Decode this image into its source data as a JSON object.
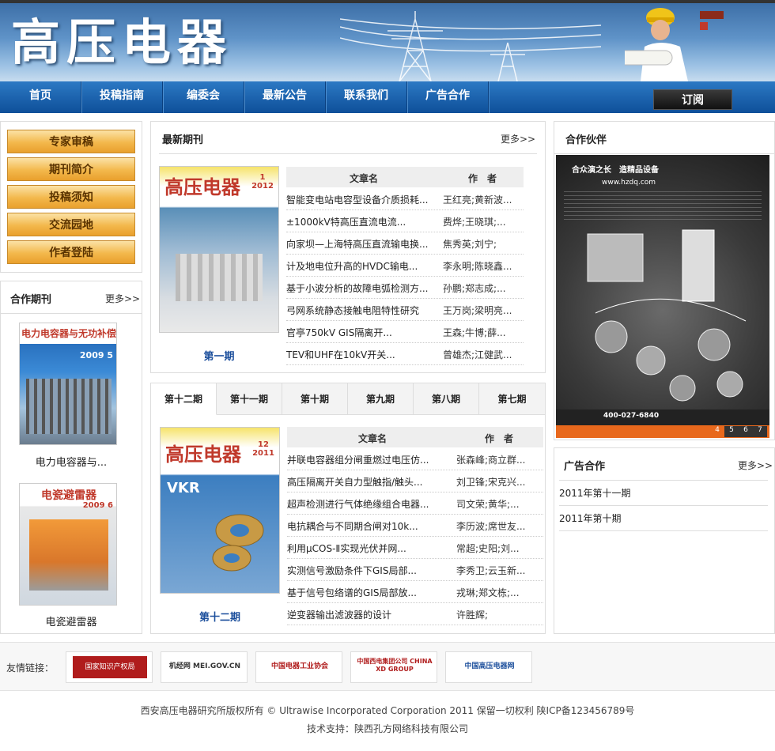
{
  "site": {
    "logo_text": "高压电器"
  },
  "nav": {
    "items": [
      "首页",
      "投稿指南",
      "编委会",
      "最新公告",
      "联系我们",
      "广告合作"
    ],
    "subscribe": "订阅"
  },
  "sidebar": {
    "buttons": [
      "专家审稿",
      "期刊简介",
      "投稿须知",
      "交流园地",
      "作者登陆"
    ]
  },
  "coop_journals": {
    "title": "合作期刊",
    "more": "更多>>",
    "items": [
      {
        "caption": "电力电容器与...",
        "cover_title": "电力电容器与无功补偿",
        "cover_issue": "2009 5"
      },
      {
        "caption": "电瓷避雷器",
        "cover_title": "电瓷避雷器",
        "cover_issue": "2009 6"
      }
    ]
  },
  "latest": {
    "title": "最新期刊",
    "more": "更多>>",
    "issue_label": "第一期",
    "cover_title": "高压电器",
    "cover_issue": "1 2012",
    "col_title": "文章名",
    "col_author": "作　者",
    "rows": [
      {
        "title": "智能变电站电容型设备介质损耗...",
        "author": "王红亮;黄新波..."
      },
      {
        "title": "±1000kV特高压直流电流...",
        "author": "费烨;王晓琪;..."
      },
      {
        "title": "向家坝—上海特高压直流输电换...",
        "author": "焦秀英;刘宁;"
      },
      {
        "title": "计及地电位升高的HVDC输电...",
        "author": "李永明;陈晓鑫..."
      },
      {
        "title": "基于小波分析的故障电弧检测方...",
        "author": "孙鹏;郑志成;..."
      },
      {
        "title": "弓网系统静态接触电阻特性研究",
        "author": "王万岗;梁明亮..."
      },
      {
        "title": "官亭750kV GIS隔离开...",
        "author": "王森;牛博;薛..."
      },
      {
        "title": "TEV和UHF在10kV开关...",
        "author": "曾雄杰;江健武..."
      }
    ]
  },
  "issues": {
    "tabs": [
      "第十二期",
      "第十一期",
      "第十期",
      "第九期",
      "第八期",
      "第七期"
    ],
    "issue_label": "第十二期",
    "cover_title": "高压电器",
    "cover_issue": "12 2011",
    "cover_brand": "VKR",
    "col_title": "文章名",
    "col_author": "作　者",
    "rows": [
      {
        "title": "并联电容器组分闸重燃过电压仿...",
        "author": "张森峰;商立群..."
      },
      {
        "title": "高压隔离开关自力型触指/触头...",
        "author": "刘卫锋;宋克兴..."
      },
      {
        "title": "超声检测进行气体绝缘组合电器...",
        "author": "司文荣;黄华;..."
      },
      {
        "title": "电抗耦合与不同期合闸对10k...",
        "author": "李历波;席世友..."
      },
      {
        "title": "利用μCOS-Ⅱ实现光伏并网...",
        "author": "常超;史阳;刘..."
      },
      {
        "title": "实测信号激励条件下GIS局部...",
        "author": "李秀卫;云玉新..."
      },
      {
        "title": "基于信号包络谱的GIS局部放...",
        "author": "戎琳;郑文栋;..."
      },
      {
        "title": "逆变器输出滤波器的设计",
        "author": "许胜辉;"
      }
    ]
  },
  "partners": {
    "title": "合作伙伴",
    "ad_heading": "合众演之长　造精品设备",
    "ad_url": "www.hzdq.com",
    "ad_phone": "400-027-6840",
    "pages": [
      "4",
      "5",
      "6",
      "7"
    ]
  },
  "ads": {
    "title": "广告合作",
    "more": "更多>>",
    "items": [
      "2011年第十一期",
      "2011年第十期"
    ]
  },
  "friends": {
    "label": "友情链接：",
    "items": [
      "国家知识产权局",
      "机经网 MEI.GOV.CN",
      "中国电器工业协会",
      "中国西电集团公司 CHINA XD GROUP",
      "中国高压电器网"
    ]
  },
  "footer": {
    "copyright": "西安高压电器研究所版权所有 © Ultrawise Incorporated Corporation 2011 保留一切权利 陕ICP备123456789号",
    "support": "技术支持：陕西孔方网络科技有限公司"
  },
  "colors": {
    "nav": "#0e4f99",
    "side_button": "#f3b84c",
    "issue_label": "#1c4f9c"
  }
}
